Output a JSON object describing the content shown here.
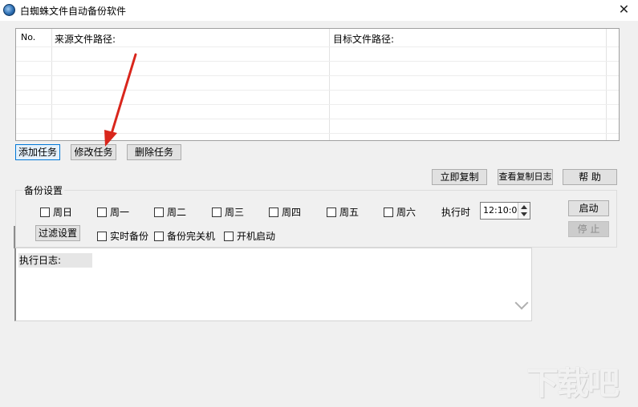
{
  "window": {
    "title": "白蜘蛛文件自动备份软件",
    "close_glyph": "✕"
  },
  "task_table": {
    "columns": [
      "No.",
      "来源文件路径:",
      "目标文件路径:"
    ],
    "rows": []
  },
  "task_buttons": {
    "add": "添加任务",
    "edit": "修改任务",
    "delete": "删除任务"
  },
  "action_buttons": {
    "copy_now": "立即复制",
    "view_log": "查看复制日志",
    "help": "帮 助"
  },
  "backup_settings": {
    "legend": "备份设置",
    "weekdays": [
      {
        "label": "周日",
        "checked": false
      },
      {
        "label": "周一",
        "checked": false
      },
      {
        "label": "周二",
        "checked": false
      },
      {
        "label": "周三",
        "checked": false
      },
      {
        "label": "周四",
        "checked": false
      },
      {
        "label": "周五",
        "checked": false
      },
      {
        "label": "周六",
        "checked": false
      }
    ],
    "exec_time_label": "执行时",
    "exec_time_value": "12:10:00",
    "filter_button": "过滤设置",
    "options": [
      {
        "label": "实时备份",
        "checked": false
      },
      {
        "label": "备份完关机",
        "checked": false
      },
      {
        "label": "开机启动",
        "checked": false
      }
    ],
    "start_button": "启动",
    "stop_button": "停 止"
  },
  "log": {
    "label": "执行日志:"
  },
  "watermark": {
    "text": "下载吧"
  },
  "icons": {
    "app": "app-logo-icon",
    "close": "close-icon",
    "spin": "spin-arrows-icon",
    "scroll": "chevron-down-icon",
    "annotation": "red-arrow-annotation"
  },
  "colors": {
    "window_bg": "#f0f0f0",
    "table_bg": "#ffffff",
    "focus_border": "#0078d7",
    "annotation_arrow": "#d9261c"
  }
}
